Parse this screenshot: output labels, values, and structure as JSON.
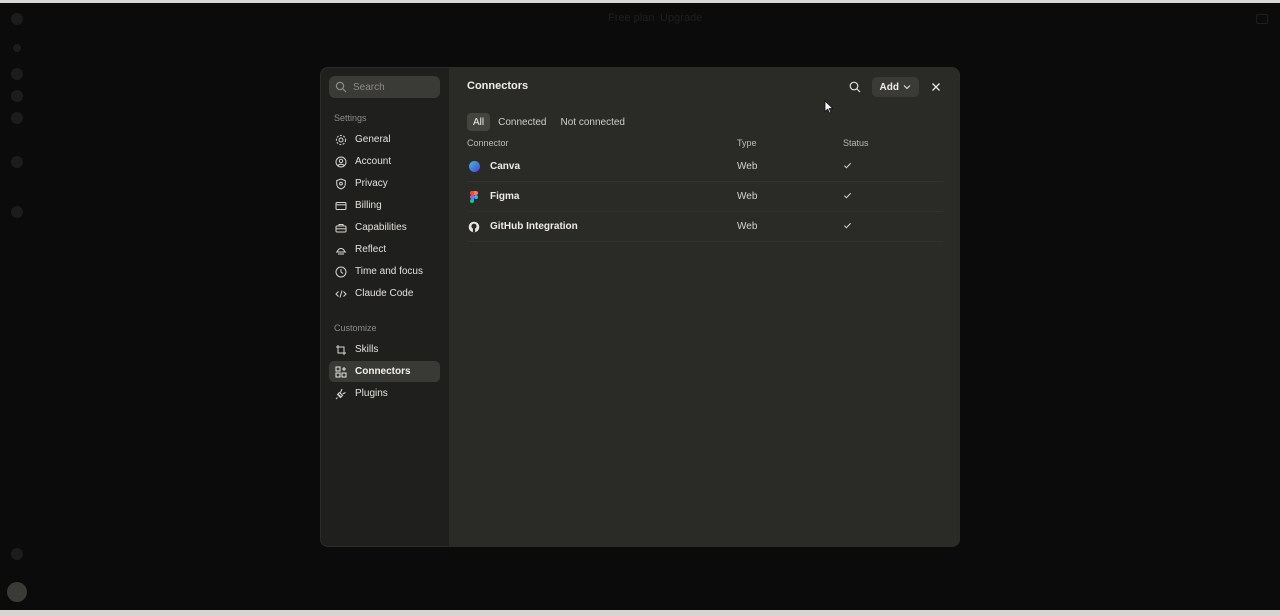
{
  "background": {
    "top_links": [
      "Free plan",
      "Upgrade"
    ]
  },
  "sidebar": {
    "search_placeholder": "Search",
    "settings_label": "Settings",
    "settings_items": [
      {
        "label": "General",
        "icon": "gear-icon"
      },
      {
        "label": "Account",
        "icon": "user-circle-icon"
      },
      {
        "label": "Privacy",
        "icon": "shield-icon"
      },
      {
        "label": "Billing",
        "icon": "credit-card-icon"
      },
      {
        "label": "Capabilities",
        "icon": "briefcase-icon"
      },
      {
        "label": "Reflect",
        "icon": "sunrise-icon"
      },
      {
        "label": "Time and focus",
        "icon": "clock-icon"
      },
      {
        "label": "Claude Code",
        "icon": "code-icon"
      }
    ],
    "customize_label": "Customize",
    "customize_items": [
      {
        "label": "Skills",
        "icon": "crop-icon"
      },
      {
        "label": "Connectors",
        "icon": "grid-plus-icon",
        "active": true
      },
      {
        "label": "Plugins",
        "icon": "plug-icon"
      }
    ]
  },
  "main": {
    "title": "Connectors",
    "add_label": "Add",
    "filters": [
      {
        "label": "All",
        "active": true
      },
      {
        "label": "Connected",
        "active": false
      },
      {
        "label": "Not connected",
        "active": false
      }
    ],
    "columns": {
      "connector": "Connector",
      "type": "Type",
      "status": "Status"
    },
    "rows": [
      {
        "name": "Canva",
        "type": "Web",
        "status": "connected",
        "logo": "canva-logo"
      },
      {
        "name": "Figma",
        "type": "Web",
        "status": "connected",
        "logo": "figma-logo"
      },
      {
        "name": "GitHub Integration",
        "type": "Web",
        "status": "connected",
        "logo": "github-logo"
      }
    ]
  },
  "colors": {
    "backdrop": "#0b0b0b",
    "sidebar": "#1f1f1d",
    "panel": "#2a2a27",
    "active_item": "#393936"
  }
}
